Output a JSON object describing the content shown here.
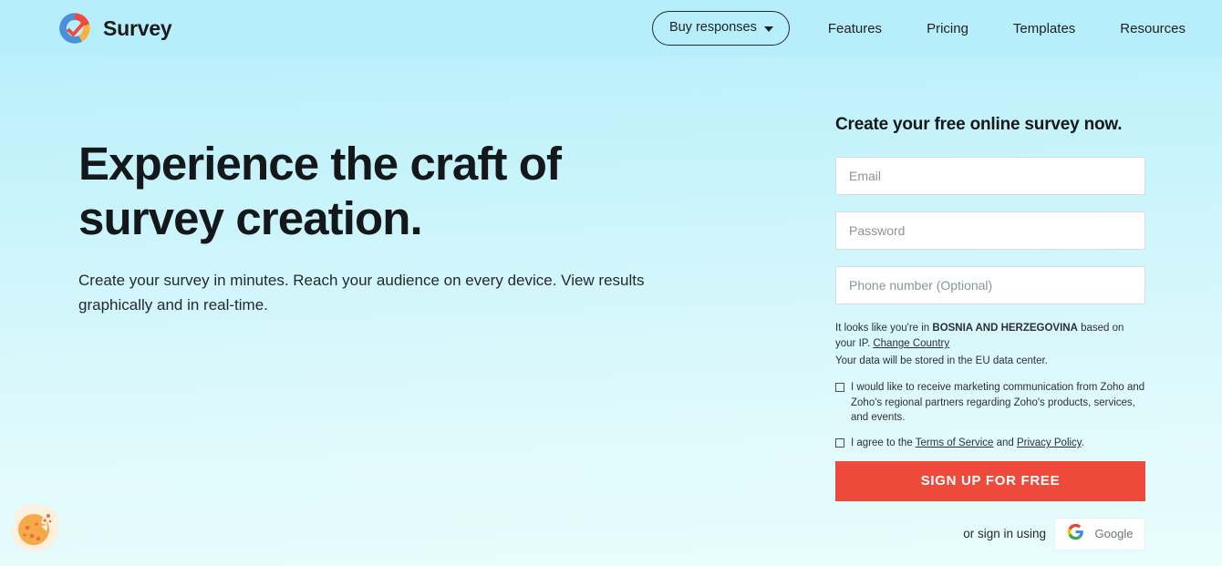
{
  "header": {
    "brand_name": "Survey",
    "logo_icon": "survey-check-circle-logo",
    "buy_button": {
      "label": "Buy responses",
      "caret_icon": "chevron-down-icon"
    },
    "nav_links": [
      {
        "label": "Features"
      },
      {
        "label": "Pricing"
      },
      {
        "label": "Templates"
      },
      {
        "label": "Resources"
      }
    ]
  },
  "hero": {
    "title": "Experience the craft of survey creation.",
    "subtitle": "Create your survey in minutes. Reach your audience on every device. View results graphically and in real-time."
  },
  "signup": {
    "title": "Create your free online survey now.",
    "fields": {
      "email_placeholder": "Email",
      "email_value": "",
      "password_placeholder": "Password",
      "password_value": "",
      "phone_placeholder": "Phone number (Optional)",
      "phone_value": ""
    },
    "geo": {
      "prefix": "It looks like you're in ",
      "country": "BOSNIA AND HERZEGOVINA",
      "suffix": " based on your IP. ",
      "change_link": "Change Country",
      "data_center": "Your data will be stored in the EU data center."
    },
    "consents": [
      {
        "id": "marketing",
        "checked": false,
        "text": "I would like to receive marketing communication from Zoho and Zoho's regional partners regarding Zoho's products, services, and events."
      }
    ],
    "terms": {
      "checked": false,
      "prefix": "I agree to the ",
      "terms_link": "Terms of Service",
      "middle": " and ",
      "privacy_link": "Privacy Policy",
      "suffix": "."
    },
    "submit_label": "SIGN UP FOR FREE",
    "social": {
      "label": "or sign in using",
      "google_label": "Google",
      "google_icon": "google-g-icon"
    }
  },
  "cookie_widget": {
    "icon": "cookie-icon",
    "label": "Cookie preferences"
  },
  "colors": {
    "accent_red": "#ee4a3c",
    "bg_top": "#b6eefb",
    "bg_bottom": "#e7fcfd",
    "text_dark": "#15181a"
  }
}
